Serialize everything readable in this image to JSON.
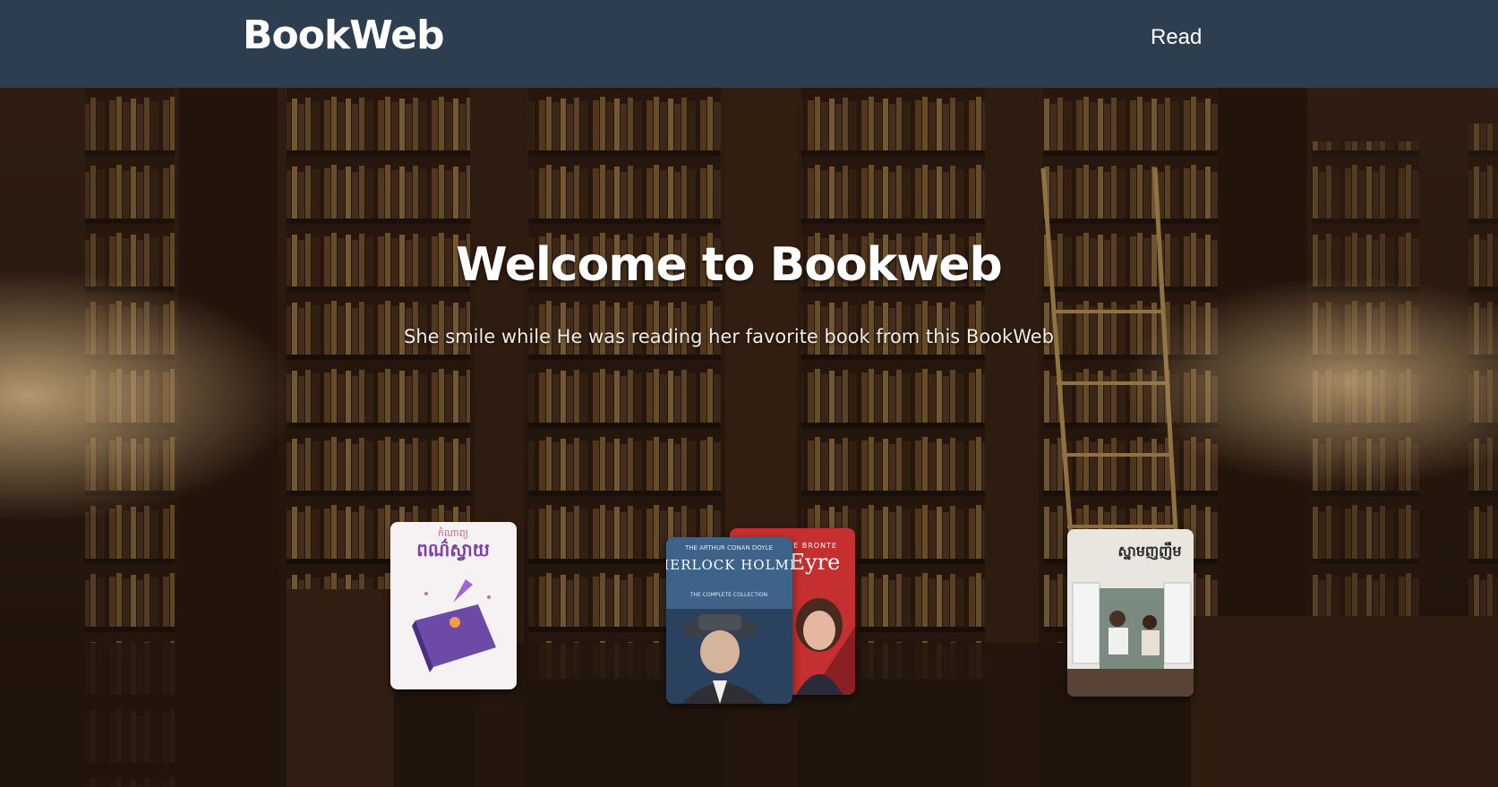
{
  "brand": "BookWeb",
  "nav": {
    "read_label": "Read"
  },
  "hero": {
    "title": "Welcome to Bookweb",
    "subtitle": "She smile while He was reading her favorite book from this BookWeb"
  },
  "books": [
    {
      "cover_text": "ពណ៌ស្វាយ",
      "cover_top": "កំណាព្យ"
    },
    {
      "cover_title": "SHERLOCK HOLMES",
      "cover_top": "THE ARTHUR CONAN DOYLE",
      "cover_sub": "THE COMPLETE COLLECTION"
    },
    {
      "cover_title": "Eyre",
      "cover_top": "E BRONTE"
    },
    {
      "cover_text": "ស្នាមញញឹម"
    }
  ],
  "colors": {
    "navbar": "#2d3e51",
    "text": "#ffffff"
  }
}
